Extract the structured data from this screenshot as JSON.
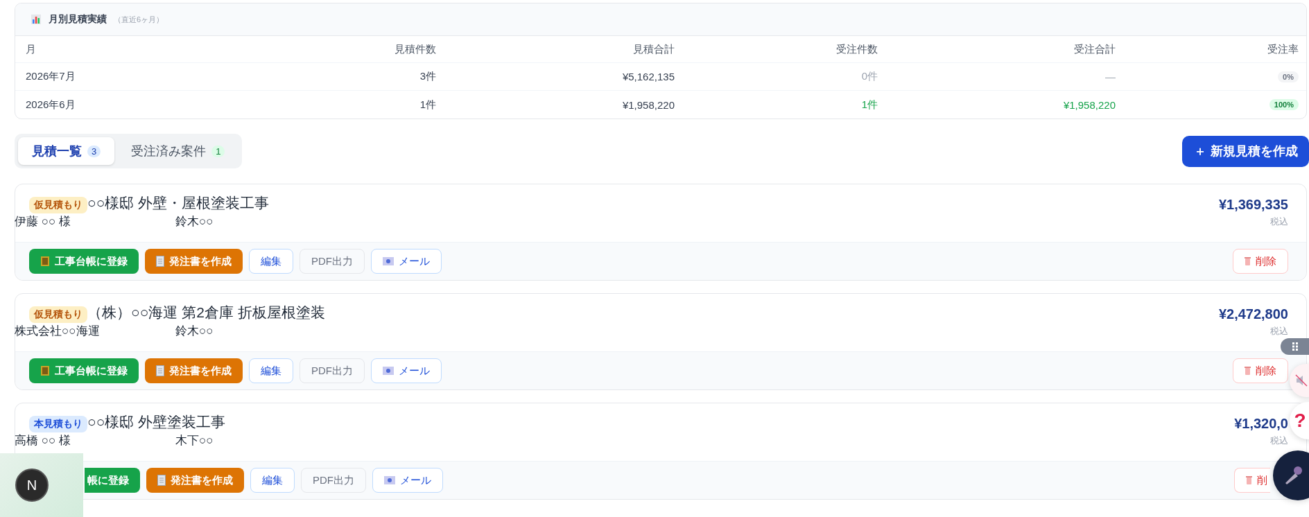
{
  "summary": {
    "title": "月別見積実績",
    "subtitle": "（直近6ヶ月）",
    "columns": [
      "月",
      "見積件数",
      "見積合計",
      "受注件数",
      "受注合計",
      "受注率"
    ],
    "rows": [
      {
        "month": "2026年7月",
        "count": "3件",
        "total": "¥5,162,135",
        "orders": "0件",
        "order_total": "—",
        "rate": "0%",
        "has_orders": false
      },
      {
        "month": "2026年6月",
        "count": "1件",
        "total": "¥1,958,220",
        "orders": "1件",
        "order_total": "¥1,958,220",
        "rate": "100%",
        "has_orders": true
      }
    ]
  },
  "tabs": [
    {
      "label": "見積一覧",
      "count": "3",
      "selected": true
    },
    {
      "label": "受注済み案件",
      "count": "1",
      "selected": false
    }
  ],
  "new_button": {
    "icon": "＋",
    "label": "新規見積を作成"
  },
  "estimates": [
    {
      "stage": "仮見積もり",
      "kind": "provisional",
      "title": "○○様邸 外壁・屋根塗装工事",
      "client": "伊藤 ○○ 様",
      "staff": "鈴木○○",
      "price": "¥1,369,335",
      "tax": "税込",
      "actions": {
        "register": "工事台帳に登録",
        "order": "発注書を作成",
        "edit": "編集",
        "pdf": "PDF出力",
        "mail": "メール",
        "delete": "削除"
      },
      "covered": false
    },
    {
      "stage": "仮見積もり",
      "kind": "provisional",
      "title": "（株）○○海運 第2倉庫 折板屋根塗装",
      "client": "株式会社○○海運",
      "staff": "鈴木○○",
      "price": "¥2,472,800",
      "tax": "税込",
      "actions": {
        "register": "工事台帳に登録",
        "order": "発注書を作成",
        "edit": "編集",
        "pdf": "PDF出力",
        "mail": "メール",
        "delete": "削除"
      },
      "covered": false
    },
    {
      "stage": "本見積もり",
      "kind": "final",
      "title": "○○様邸 外壁塗装工事",
      "client": "高橋 ○○ 様",
      "staff": "木下○○",
      "price": "¥1,320,0",
      "tax": "税込",
      "actions": {
        "register": "帳に登録",
        "order": "発注書を作成",
        "edit": "編集",
        "pdf": "PDF出力",
        "mail": "メール",
        "delete": "削"
      },
      "covered": true
    }
  ],
  "help_button": {
    "label": "?"
  },
  "dev_badge": {
    "letter": "N"
  }
}
